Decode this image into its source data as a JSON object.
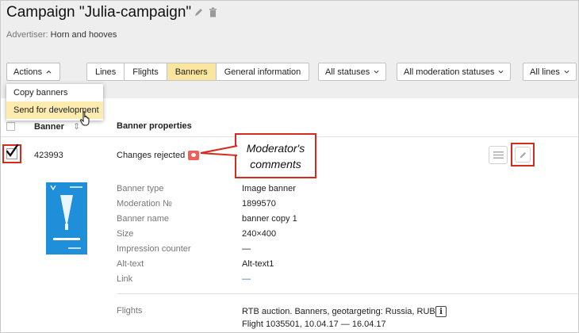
{
  "header": {
    "campaign_title": "Campaign \"Julia-campaign\"",
    "advertiser_label": "Advertiser:",
    "advertiser_name": "Horn and hooves"
  },
  "toolbar": {
    "actions_label": "Actions",
    "tabs": [
      {
        "label": "Lines",
        "active": false
      },
      {
        "label": "Flights",
        "active": false
      },
      {
        "label": "Banners",
        "active": true
      },
      {
        "label": "General information",
        "active": false
      }
    ],
    "filter_statuses": "All statuses",
    "filter_moderation": "All moderation statuses",
    "filter_lines": "All lines"
  },
  "actions_menu": {
    "items": [
      {
        "label": "Copy banners",
        "highlighted": false
      },
      {
        "label": "Send for development",
        "highlighted": true
      }
    ]
  },
  "table": {
    "col_banner": "Banner",
    "col_properties": "Banner properties"
  },
  "row": {
    "banner_id": "423993",
    "status": "Changes rejected",
    "callout_line1": "Moderator's",
    "callout_line2": "comments",
    "properties": [
      {
        "label": "Banner type",
        "value": "Image banner"
      },
      {
        "label": "Moderation №",
        "value": "1899570"
      },
      {
        "label": "Banner name",
        "value": "banner copy 1"
      },
      {
        "label": "Size",
        "value": "240×400"
      },
      {
        "label": "Impression counter",
        "value": "—"
      },
      {
        "label": "Alt-text",
        "value": "Alt-text1"
      },
      {
        "label": "Link",
        "value": "—"
      }
    ],
    "flights_label": "Flights",
    "flights_line1": "RTB auction. Banners, geotargeting: Russia, RUB",
    "flights_line2": "Flight 1035501, 10.04.17 — 16.04.17",
    "info_symbol": "i"
  },
  "colors": {
    "accent_yellow": "#fbe6a0",
    "highlight_red": "#d42b1e",
    "comment_badge": "#f0605a",
    "banner_blue": "#1e8fd8"
  }
}
